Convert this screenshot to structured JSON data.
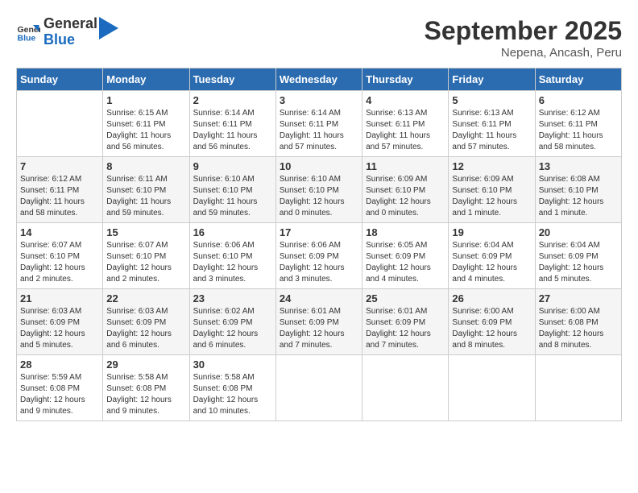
{
  "logo": {
    "line1": "General",
    "line2": "Blue"
  },
  "title": "September 2025",
  "subtitle": "Nepena, Ancash, Peru",
  "headers": [
    "Sunday",
    "Monday",
    "Tuesday",
    "Wednesday",
    "Thursday",
    "Friday",
    "Saturday"
  ],
  "weeks": [
    [
      {
        "day": "",
        "info": ""
      },
      {
        "day": "1",
        "info": "Sunrise: 6:15 AM\nSunset: 6:11 PM\nDaylight: 11 hours\nand 56 minutes."
      },
      {
        "day": "2",
        "info": "Sunrise: 6:14 AM\nSunset: 6:11 PM\nDaylight: 11 hours\nand 56 minutes."
      },
      {
        "day": "3",
        "info": "Sunrise: 6:14 AM\nSunset: 6:11 PM\nDaylight: 11 hours\nand 57 minutes."
      },
      {
        "day": "4",
        "info": "Sunrise: 6:13 AM\nSunset: 6:11 PM\nDaylight: 11 hours\nand 57 minutes."
      },
      {
        "day": "5",
        "info": "Sunrise: 6:13 AM\nSunset: 6:11 PM\nDaylight: 11 hours\nand 57 minutes."
      },
      {
        "day": "6",
        "info": "Sunrise: 6:12 AM\nSunset: 6:11 PM\nDaylight: 11 hours\nand 58 minutes."
      }
    ],
    [
      {
        "day": "7",
        "info": "Sunrise: 6:12 AM\nSunset: 6:11 PM\nDaylight: 11 hours\nand 58 minutes."
      },
      {
        "day": "8",
        "info": "Sunrise: 6:11 AM\nSunset: 6:10 PM\nDaylight: 11 hours\nand 59 minutes."
      },
      {
        "day": "9",
        "info": "Sunrise: 6:10 AM\nSunset: 6:10 PM\nDaylight: 11 hours\nand 59 minutes."
      },
      {
        "day": "10",
        "info": "Sunrise: 6:10 AM\nSunset: 6:10 PM\nDaylight: 12 hours\nand 0 minutes."
      },
      {
        "day": "11",
        "info": "Sunrise: 6:09 AM\nSunset: 6:10 PM\nDaylight: 12 hours\nand 0 minutes."
      },
      {
        "day": "12",
        "info": "Sunrise: 6:09 AM\nSunset: 6:10 PM\nDaylight: 12 hours\nand 1 minute."
      },
      {
        "day": "13",
        "info": "Sunrise: 6:08 AM\nSunset: 6:10 PM\nDaylight: 12 hours\nand 1 minute."
      }
    ],
    [
      {
        "day": "14",
        "info": "Sunrise: 6:07 AM\nSunset: 6:10 PM\nDaylight: 12 hours\nand 2 minutes."
      },
      {
        "day": "15",
        "info": "Sunrise: 6:07 AM\nSunset: 6:10 PM\nDaylight: 12 hours\nand 2 minutes."
      },
      {
        "day": "16",
        "info": "Sunrise: 6:06 AM\nSunset: 6:10 PM\nDaylight: 12 hours\nand 3 minutes."
      },
      {
        "day": "17",
        "info": "Sunrise: 6:06 AM\nSunset: 6:09 PM\nDaylight: 12 hours\nand 3 minutes."
      },
      {
        "day": "18",
        "info": "Sunrise: 6:05 AM\nSunset: 6:09 PM\nDaylight: 12 hours\nand 4 minutes."
      },
      {
        "day": "19",
        "info": "Sunrise: 6:04 AM\nSunset: 6:09 PM\nDaylight: 12 hours\nand 4 minutes."
      },
      {
        "day": "20",
        "info": "Sunrise: 6:04 AM\nSunset: 6:09 PM\nDaylight: 12 hours\nand 5 minutes."
      }
    ],
    [
      {
        "day": "21",
        "info": "Sunrise: 6:03 AM\nSunset: 6:09 PM\nDaylight: 12 hours\nand 5 minutes."
      },
      {
        "day": "22",
        "info": "Sunrise: 6:03 AM\nSunset: 6:09 PM\nDaylight: 12 hours\nand 6 minutes."
      },
      {
        "day": "23",
        "info": "Sunrise: 6:02 AM\nSunset: 6:09 PM\nDaylight: 12 hours\nand 6 minutes."
      },
      {
        "day": "24",
        "info": "Sunrise: 6:01 AM\nSunset: 6:09 PM\nDaylight: 12 hours\nand 7 minutes."
      },
      {
        "day": "25",
        "info": "Sunrise: 6:01 AM\nSunset: 6:09 PM\nDaylight: 12 hours\nand 7 minutes."
      },
      {
        "day": "26",
        "info": "Sunrise: 6:00 AM\nSunset: 6:09 PM\nDaylight: 12 hours\nand 8 minutes."
      },
      {
        "day": "27",
        "info": "Sunrise: 6:00 AM\nSunset: 6:08 PM\nDaylight: 12 hours\nand 8 minutes."
      }
    ],
    [
      {
        "day": "28",
        "info": "Sunrise: 5:59 AM\nSunset: 6:08 PM\nDaylight: 12 hours\nand 9 minutes."
      },
      {
        "day": "29",
        "info": "Sunrise: 5:58 AM\nSunset: 6:08 PM\nDaylight: 12 hours\nand 9 minutes."
      },
      {
        "day": "30",
        "info": "Sunrise: 5:58 AM\nSunset: 6:08 PM\nDaylight: 12 hours\nand 10 minutes."
      },
      {
        "day": "",
        "info": ""
      },
      {
        "day": "",
        "info": ""
      },
      {
        "day": "",
        "info": ""
      },
      {
        "day": "",
        "info": ""
      }
    ]
  ]
}
